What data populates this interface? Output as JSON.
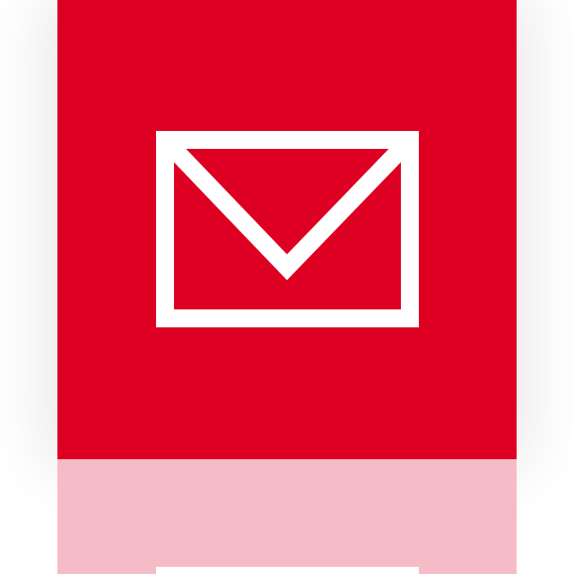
{
  "app": {
    "icon": "mail-envelope-icon",
    "colors": {
      "tile": "#dd0022",
      "glyph": "#ffffff",
      "reflection": "#f5bcc7"
    }
  }
}
